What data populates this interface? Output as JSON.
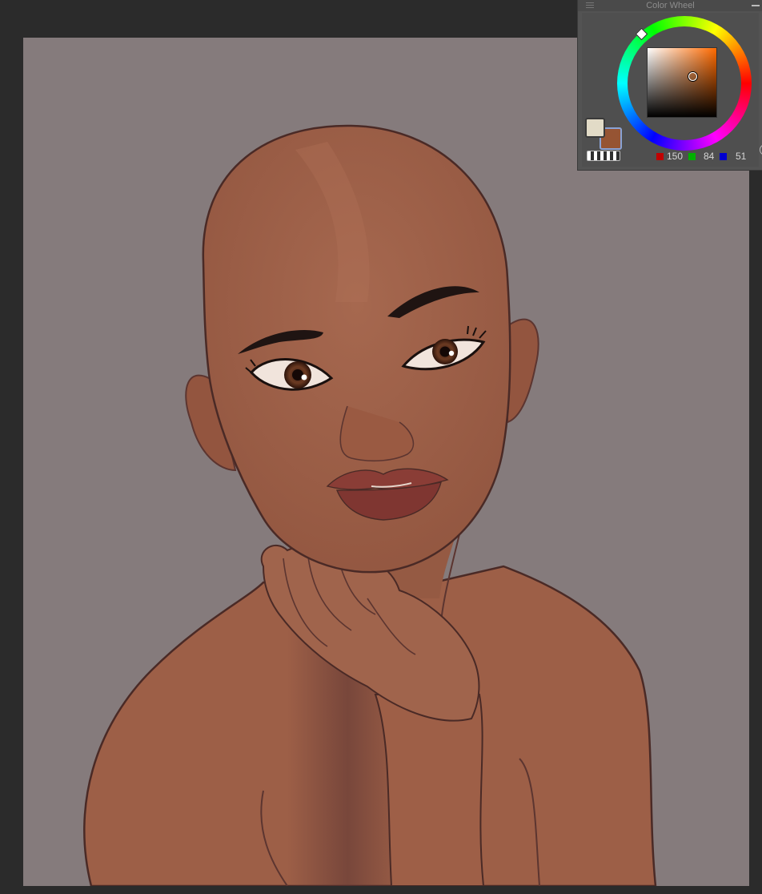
{
  "color_panel": {
    "title": "Color Wheel",
    "foreground_color": "#e2dbc7",
    "background_color": "#965433",
    "rgb": {
      "r": "150",
      "g": "84",
      "b": "51"
    },
    "icons": {
      "grip": "grip-icon",
      "minimize": "minimize-icon",
      "transparent": "transparent-color-icon"
    }
  },
  "canvas": {
    "background_color": "#857b7c"
  }
}
